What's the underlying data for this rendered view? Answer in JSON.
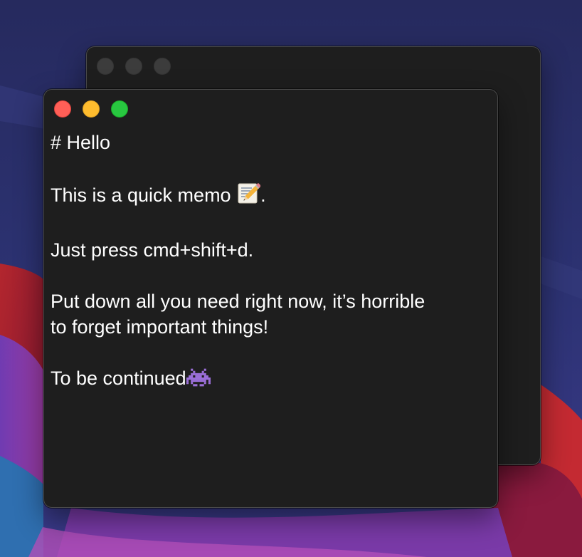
{
  "editor": {
    "lines": {
      "heading": "# Hello",
      "memo_text": "This is a quick memo ",
      "memo_end": ".",
      "shortcut": "Just press cmd+shift+d.",
      "reminder_1": "Put down all you need right now, it’s horrible",
      "reminder_2": "to forget important things!",
      "closing": "To be continued"
    },
    "emoji": {
      "memo": "memo-pencil-emoji",
      "closing": "alien-monster-emoji"
    }
  },
  "colors": {
    "window_bg": "#1e1e1e",
    "close": "#ff5f57",
    "minimize": "#febc2e",
    "zoom": "#28c840",
    "inactive_dot": "#3c3c3c",
    "text": "#ffffff"
  }
}
